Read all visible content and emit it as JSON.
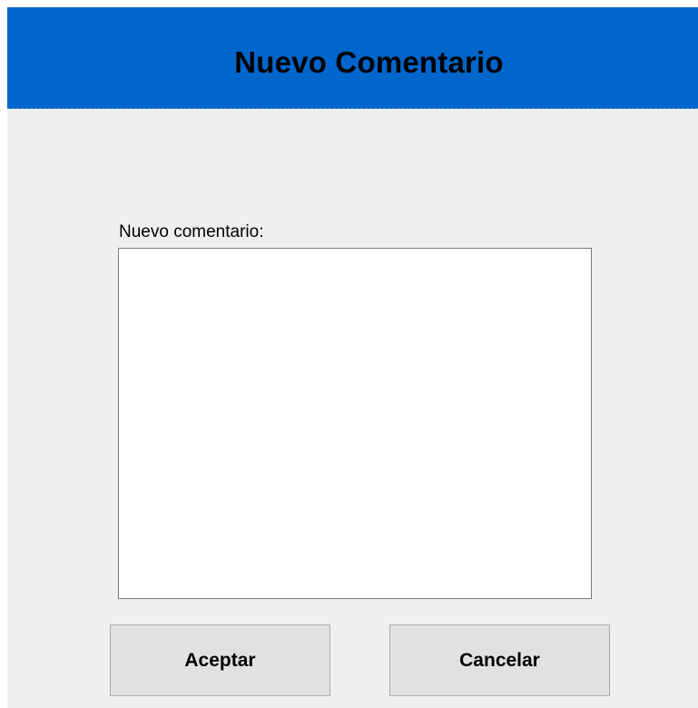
{
  "dialog": {
    "title": "Nuevo Comentario",
    "field_label": "Nuevo comentario:",
    "comment_value": "",
    "accept_label": "Aceptar",
    "cancel_label": "Cancelar"
  },
  "colors": {
    "header_background": "#0066cc",
    "window_background": "#efefef",
    "button_background": "#e1e1e1"
  }
}
